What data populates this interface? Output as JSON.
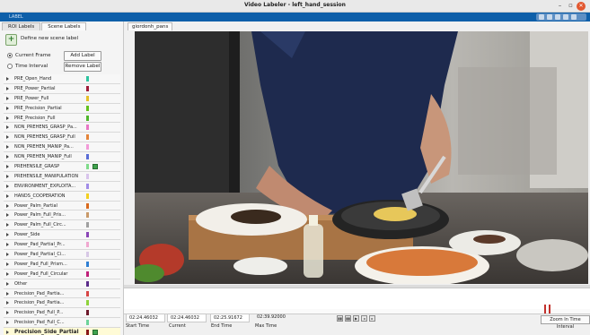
{
  "window": {
    "title": "Video Labeler - left_hand_session",
    "min_glyph": "–",
    "max_glyph": "▫",
    "close_glyph": "✕"
  },
  "ribbon": {
    "tab_label": "LABEL"
  },
  "left_panel": {
    "tabs": [
      "ROI Labels",
      "Scene Labels"
    ],
    "define_label": "Define new scene label",
    "options": [
      "Current Frame",
      "Time Interval"
    ],
    "add_label": "Add Label",
    "remove_label": "Remove Label",
    "labels": [
      {
        "name": "PRE_Open_Hand",
        "color": "#2ec4a0"
      },
      {
        "name": "PRE_Power_Partial",
        "color": "#a01d3a"
      },
      {
        "name": "PRE_Power_Full",
        "color": "#e6c02a"
      },
      {
        "name": "PRE_Precision_Partial",
        "color": "#63c21e"
      },
      {
        "name": "PRE_Precision_Full",
        "color": "#4fb62c"
      },
      {
        "name": "NON_PREHENS_GRASP_Pa...",
        "color": "#e877c6"
      },
      {
        "name": "NON_PREHENS_GRASP_Full",
        "color": "#e5853a"
      },
      {
        "name": "NON_PREHEN_MANIP_Pa...",
        "color": "#f29ad8"
      },
      {
        "name": "NON_PREHEN_MANIP_Full",
        "color": "#5a6dd6"
      },
      {
        "name": "PREHENSILE_GRASP",
        "color": "#7fdc8a"
      },
      {
        "name": "PREHENSILE_MANIPULATION",
        "color": "#d8c4ec"
      },
      {
        "name": "ENVIRONMENT_EXPLOITA...",
        "color": "#a18ce8"
      },
      {
        "name": "HANDS_COOPERATION",
        "color": "#f3d020"
      },
      {
        "name": "Power_Palm_Partial",
        "color": "#d96a1e"
      },
      {
        "name": "Power_Palm_Full_Pris...",
        "color": "#c99a6a"
      },
      {
        "name": "Power_Palm_Full_Circ...",
        "color": "#a0a0a0"
      },
      {
        "name": "Power_Side",
        "color": "#8a45b6"
      },
      {
        "name": "Power_Pad_Partial_Pr...",
        "color": "#f0a8d0"
      },
      {
        "name": "Power_Pad_Partial_Ci...",
        "color": "#d7c8e6"
      },
      {
        "name": "Power_Pad_Full_Prism...",
        "color": "#2f7fd3"
      },
      {
        "name": "Power_Pad_Full_Circular",
        "color": "#c0207a"
      },
      {
        "name": "Other",
        "color": "#5b2c8a"
      },
      {
        "name": "Precision_Pad_Partia...",
        "color": "#d74646"
      },
      {
        "name": "Precision_Pad_Partia...",
        "color": "#8fd23c"
      },
      {
        "name": "Precision_Pad_Full_P...",
        "color": "#6e1a2c"
      },
      {
        "name": "Precision_Pad_Full_C...",
        "color": "#6ed39a"
      },
      {
        "name": "Precision_Side_Partial",
        "color": "#8a1a1a"
      }
    ]
  },
  "main": {
    "signal_tab": "giordonh_pans",
    "time": {
      "start_value": "02:24.46032",
      "current_value": "02:24.46032",
      "end_value": "02:25.91672",
      "max_value": "02:39.92000",
      "start_caption": "Start Time",
      "current_caption": "Current",
      "end_caption": "End Time",
      "max_caption": "Max Time"
    },
    "controls": [
      "▮▮",
      "▮▮",
      "▶",
      "◂",
      "▸"
    ],
    "zoom_label": "Zoom In Time Interval"
  },
  "colors": {
    "ribbon": "#0e5fa9",
    "selected_row": "#fffbd6",
    "marker": "#c2302b"
  }
}
